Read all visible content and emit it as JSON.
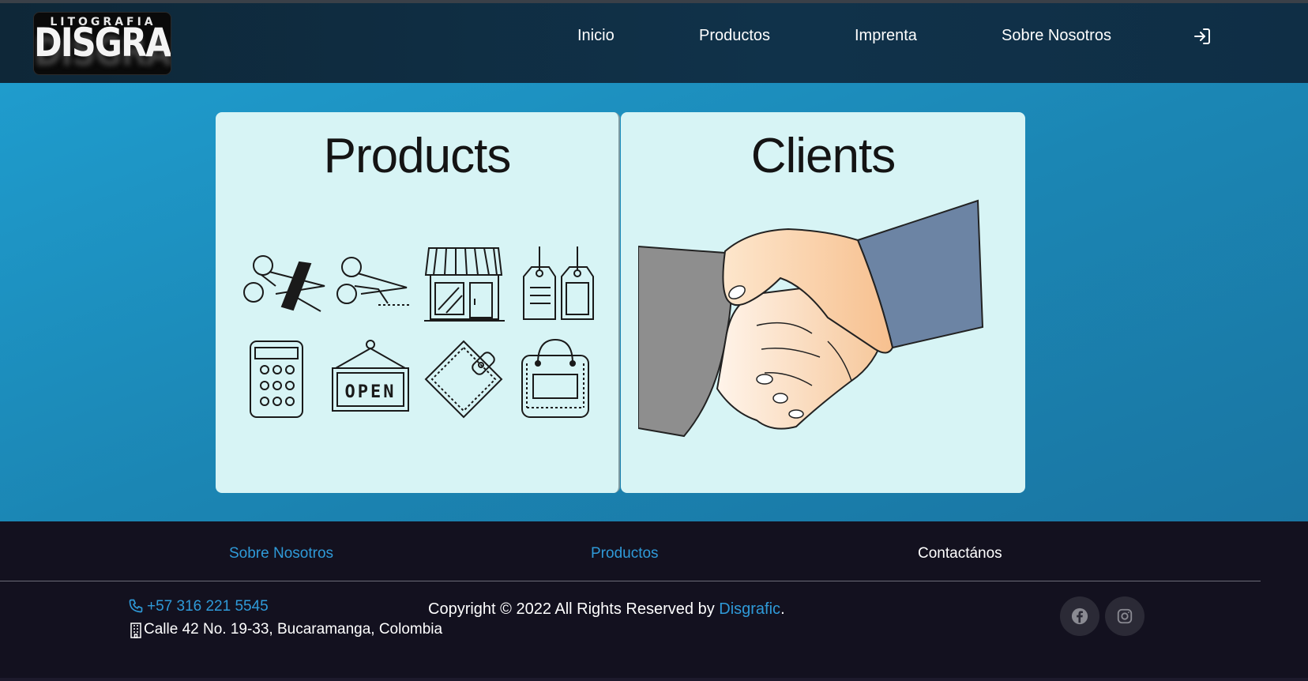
{
  "brand": {
    "logo_top": "LITOGRAFIA",
    "logo_main": "DISGRAFIC"
  },
  "nav": {
    "items": [
      {
        "label": "Inicio"
      },
      {
        "label": "Productos"
      },
      {
        "label": "Imprenta"
      },
      {
        "label": "Sobre Nosotros"
      }
    ],
    "login_icon": "sign-in-icon"
  },
  "cards": {
    "products": {
      "title": "Products",
      "icons": [
        "scissors-cut-icon",
        "scissors-dotted-icon",
        "storefront-icon",
        "price-tags-icon",
        "calculator-icon",
        "open-sign-icon",
        "wallet-icon",
        "shopping-bag-icon"
      ],
      "open_sign_text": "OPEN"
    },
    "clients": {
      "title": "Clients",
      "image": "handshake-illustration"
    }
  },
  "footer": {
    "links": [
      {
        "label": "Sobre Nosotros"
      },
      {
        "label": "Productos"
      },
      {
        "label": "Contactános"
      }
    ],
    "phone": "+57 316 221 5545",
    "address": "Calle 42 No. 19-33, Bucaramanga, Colombia",
    "copyright_prefix": "Copyright © 2022 All Rights Reserved by ",
    "copyright_brand": "Disgrafic",
    "copyright_suffix": ".",
    "social": [
      "facebook-icon",
      "instagram-icon"
    ]
  },
  "colors": {
    "nav_bg": "#10324a",
    "hero_bg": "#1b86b4",
    "card_bg": "#d7f4f5",
    "footer_bg": "#13111f",
    "link_blue": "#2f9ad8"
  }
}
